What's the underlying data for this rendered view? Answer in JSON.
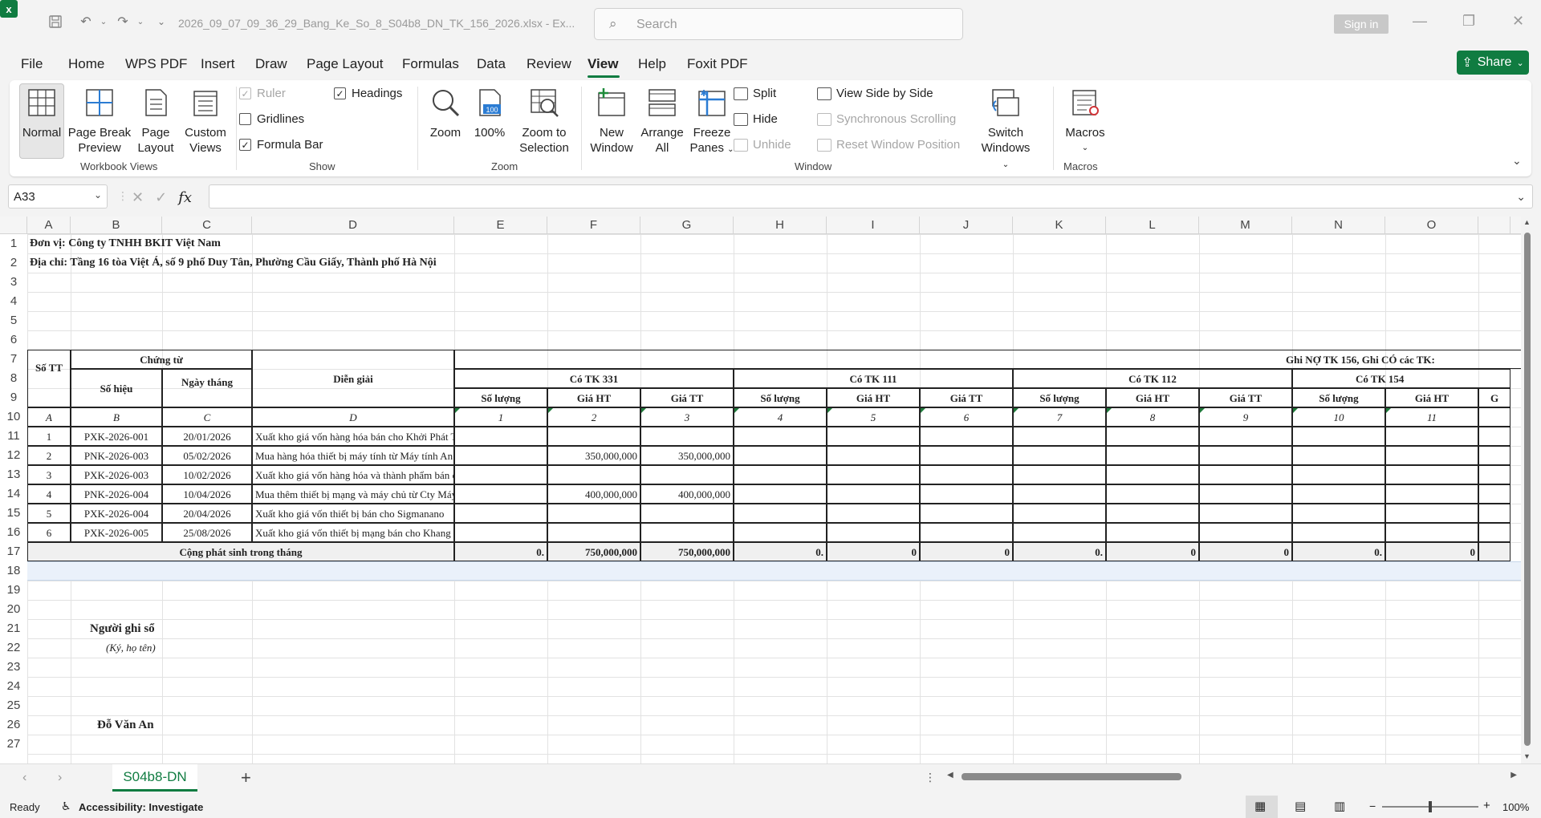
{
  "titlebar": {
    "app_icon": "excel-icon",
    "file_title": "2026_09_07_09_36_29_Bang_Ke_So_8_S04b8_DN_TK_156_2026.xlsx  -  Ex...",
    "search_placeholder": "Search",
    "signin_label": "Sign in"
  },
  "menu": {
    "tabs": [
      "File",
      "Home",
      "WPS PDF",
      "Insert",
      "Draw",
      "Page Layout",
      "Formulas",
      "Data",
      "Review",
      "View",
      "Help",
      "Foxit PDF"
    ],
    "active": "View",
    "share_label": "Share"
  },
  "ribbon": {
    "workbook_views": {
      "label": "Workbook Views",
      "normal": "Normal",
      "page_break_1": "Page Break",
      "page_break_2": "Preview",
      "page_layout_1": "Page",
      "page_layout_2": "Layout",
      "custom_views_1": "Custom",
      "custom_views_2": "Views"
    },
    "show": {
      "label": "Show",
      "ruler": "Ruler",
      "gridlines": "Gridlines",
      "formula_bar": "Formula Bar",
      "headings": "Headings"
    },
    "zoom": {
      "label": "Zoom",
      "zoom": "Zoom",
      "hundred": "100%",
      "zoom_sel_1": "Zoom to",
      "zoom_sel_2": "Selection"
    },
    "window": {
      "label": "Window",
      "new_window_1": "New",
      "new_window_2": "Window",
      "arrange_1": "Arrange",
      "arrange_2": "All",
      "freeze_1": "Freeze",
      "freeze_2": "Panes",
      "split": "Split",
      "hide": "Hide",
      "unhide": "Unhide",
      "side_by_side": "View Side by Side",
      "sync_scroll": "Synchronous Scrolling",
      "reset_pos": "Reset Window Position",
      "switch_1": "Switch",
      "switch_2": "Windows"
    },
    "macros": {
      "label": "Macros",
      "macros": "Macros"
    }
  },
  "formula_bar": {
    "name_box": "A33",
    "fx": "fx",
    "value": ""
  },
  "columns": [
    "A",
    "B",
    "C",
    "D",
    "E",
    "F",
    "G",
    "H",
    "I",
    "J",
    "K",
    "L",
    "M",
    "N",
    "O"
  ],
  "rows": [
    "1",
    "2",
    "3",
    "4",
    "5",
    "6",
    "7",
    "8",
    "9",
    "10",
    "11",
    "12",
    "13",
    "14",
    "15",
    "16",
    "17",
    "18",
    "19",
    "20",
    "21",
    "22",
    "23",
    "24",
    "25",
    "26",
    "27"
  ],
  "sheet": {
    "unit": "Đơn vị: Công ty TNHH BKIT Việt Nam",
    "address": "Địa chỉ: Tầng 16 tòa Việt Á, số 9 phố Duy Tân, Phường Cầu Giấy, Thành phố Hà Nội",
    "header": {
      "so_tt": "Số TT",
      "chung_tu": "Chứng từ",
      "so_hieu": "Số hiệu",
      "ngay_thang": "Ngày tháng",
      "dien_giai": "Diễn giải",
      "ghi_no": "Ghi NỢ TK 156, Ghi CÓ các TK:",
      "co_331": "Có TK 331",
      "co_111": "Có TK 111",
      "co_112": "Có TK 112",
      "co_154": "Có TK 154",
      "so_luong": "Số lượng",
      "gia_ht": "Giá HT",
      "gia_tt": "Giá TT",
      "cut_col": "G"
    },
    "col_index": [
      "A",
      "B",
      "C",
      "D",
      "1",
      "2",
      "3",
      "4",
      "5",
      "6",
      "7",
      "8",
      "9",
      "10",
      "11"
    ],
    "data_rows": [
      {
        "stt": "1",
        "so_hieu": "PXK-2026-001",
        "ngay": "20/01/2026",
        "dien_giai": "Xuất kho giá vốn hàng hóa bán cho Khởi Phát Technology",
        "f": "",
        "g": ""
      },
      {
        "stt": "2",
        "so_hieu": "PNK-2026-003",
        "ngay": "05/02/2026",
        "dien_giai": "Mua hàng hóa thiết bị máy tính từ Máy tính An Phát",
        "f": "350,000,000",
        "g": "350,000,000"
      },
      {
        "stt": "3",
        "so_hieu": "PXK-2026-003",
        "ngay": "10/02/2026",
        "dien_giai": "Xuất kho giá vốn hàng hóa và thành phẩm bán cho Hotwave Trade",
        "f": "",
        "g": ""
      },
      {
        "stt": "4",
        "so_hieu": "PNK-2026-004",
        "ngay": "10/04/2026",
        "dien_giai": "Mua thêm thiết bị mạng và máy chủ từ Cty Máy tính An Phát",
        "f": "400,000,000",
        "g": "400,000,000"
      },
      {
        "stt": "5",
        "so_hieu": "PXK-2026-004",
        "ngay": "20/04/2026",
        "dien_giai": "Xuất kho giá vốn thiết bị bán cho Sigmanano",
        "f": "",
        "g": ""
      },
      {
        "stt": "6",
        "so_hieu": "PXK-2026-005",
        "ngay": "25/08/2026",
        "dien_giai": "Xuất kho giá vốn thiết bị mạng bán cho Khang Tam Anh",
        "f": "",
        "g": ""
      }
    ],
    "total": {
      "label": "Cộng phát sinh trong tháng",
      "values": [
        "0.",
        "750,000,000",
        "750,000,000",
        "0.",
        "0",
        "0",
        "0.",
        "0",
        "0",
        "0.",
        "0"
      ]
    },
    "signer_title": "Người ghi sổ",
    "signer_note": "(Ký, họ tên)",
    "signer_name": "Đỗ Văn An"
  },
  "tabs": {
    "sheet_name": "S04b8-DN",
    "add": "+"
  },
  "status": {
    "ready": "Ready",
    "accessibility": "Accessibility: Investigate",
    "zoom": "100%"
  }
}
